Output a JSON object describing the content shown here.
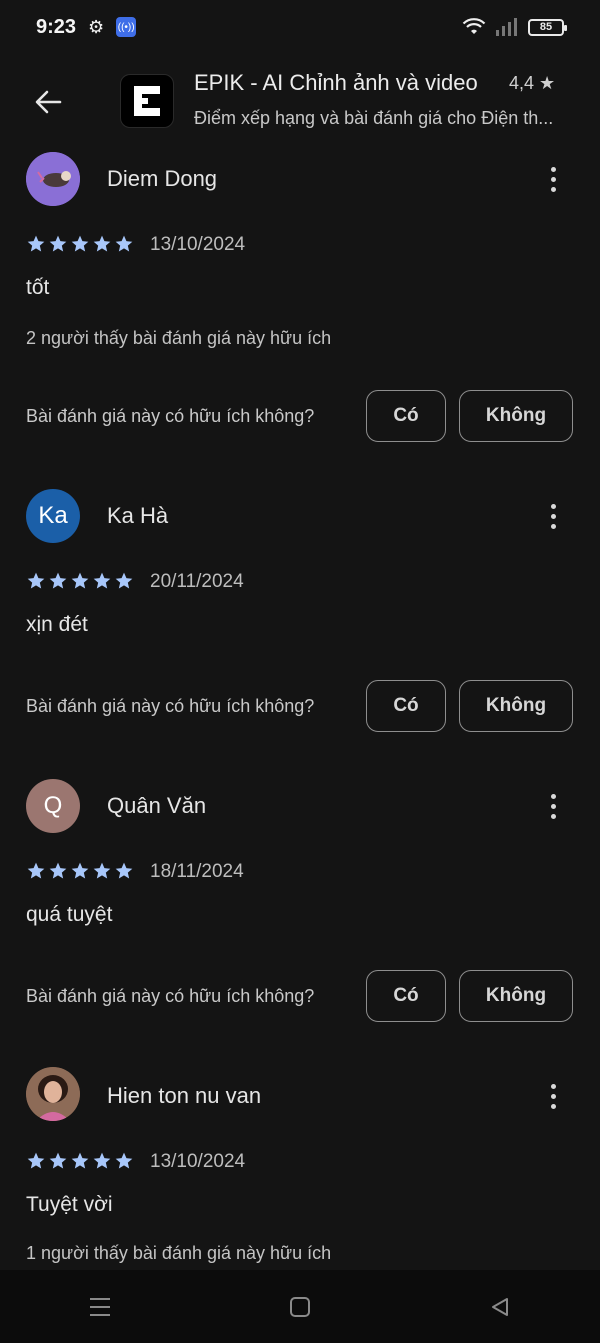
{
  "status": {
    "time": "9:23",
    "battery": "85"
  },
  "header": {
    "title": "EPIK - AI Chỉnh ảnh và video",
    "rating": "4,4 ★",
    "subtitle": "Điểm xếp hạng và bài đánh giá cho Điện th..."
  },
  "question_label": "Bài đánh giá này có hữu ích không?",
  "yes_label": "Có",
  "no_label": "Không",
  "reviews": [
    {
      "name": "Diem Dong",
      "date": "13/10/2024",
      "text": "tốt",
      "helpful": "2 người thấy bài đánh giá này hữu ích",
      "stars": 5,
      "avatar_color": "#8a6fd6"
    },
    {
      "name": "Ka Hà",
      "initials": "Ka",
      "date": "20/11/2024",
      "text": "xịn đét",
      "stars": 5,
      "avatar_color": "#1b5fa8"
    },
    {
      "name": "Quân Văn",
      "initials": "Q",
      "date": "18/11/2024",
      "text": "quá tuyệt",
      "stars": 5,
      "avatar_color": "#9b7670"
    },
    {
      "name": "Hien ton nu van",
      "date": "13/10/2024",
      "text": "Tuyệt vời",
      "helpful": "1 người thấy bài đánh giá này hữu ích",
      "stars": 5,
      "avatar_color": "#7a5a48"
    }
  ],
  "colors": {
    "star": "#a8c7fa",
    "background": "#141414"
  }
}
